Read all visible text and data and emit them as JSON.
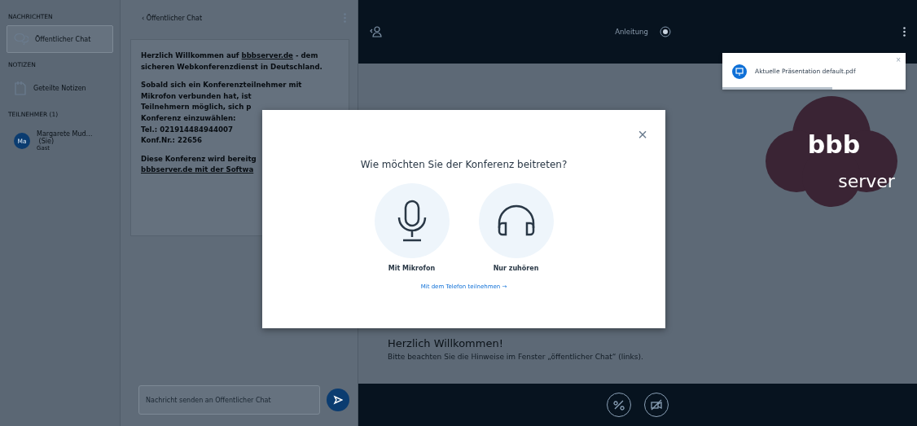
{
  "sidebar": {
    "sections": [
      {
        "title": "NACHRICHTEN",
        "items": [
          {
            "kind": "chat",
            "label": "Öffentlicher Chat",
            "selected": true
          }
        ]
      },
      {
        "title": "NOTIZEN",
        "items": [
          {
            "kind": "notes",
            "label": "Geteilte Notizen",
            "selected": false
          }
        ]
      },
      {
        "title": "TEILNEHMER (1)",
        "items": [
          {
            "kind": "user",
            "avatar": "Ma",
            "label": "Margarete Mud…",
            "suffix": "(Sie)",
            "sub": "Gast",
            "selected": false
          }
        ]
      }
    ]
  },
  "chat": {
    "title": "Öffentlicher Chat",
    "back": "‹",
    "paragraphs": [
      [
        [
          {
            "kind": "bold",
            "text": "Herzlich Willkommen auf "
          },
          {
            "kind": "link",
            "text": "bbbserver.de"
          },
          {
            "kind": "bold",
            "text": " - dem"
          }
        ],
        [
          {
            "kind": "bold",
            "text": "sicheren Webkonferenzdienst in Deutschland."
          }
        ]
      ],
      [
        [
          {
            "kind": "bold",
            "text": "Sobald sich ein Konferenzteilnehmer mit"
          }
        ],
        [
          {
            "kind": "bold",
            "text": "Mikrofon verbunden hat, ist"
          }
        ],
        [
          {
            "kind": "bold",
            "text": "Teilnehmern möglich, sich p"
          }
        ],
        [
          {
            "kind": "bold",
            "text": "Konferenz einzuwählen:"
          }
        ],
        [
          {
            "kind": "bold",
            "text": "Tel.: 021914484944007"
          }
        ],
        [
          {
            "kind": "bold",
            "text": "Konf.Nr.: 22656"
          }
        ]
      ],
      [
        [
          {
            "kind": "bold",
            "text": "Diese Konferenz wird bereitg"
          }
        ],
        [
          {
            "kind": "link",
            "text": "bbbserver.de mit der Softwa"
          }
        ]
      ]
    ],
    "input": {
      "placeholder": "Nachricht senden an Öffentlicher Chat"
    }
  },
  "topbar": {
    "title": "Anleitung"
  },
  "presentation": {
    "logo_top": "bbb",
    "logo_bottom": "server",
    "heading": "Herzlich Willkommen!",
    "hint": "Bitte beachten Sie die Hinweise im Fenster „öffentlicher Chat“ (links)."
  },
  "toast": {
    "text": "Aktuelle Präsentation default.pdf",
    "close": "×",
    "level": 0.6
  },
  "modal": {
    "title": "Wie möchten Sie der Konferenz beitreten?",
    "close": "×",
    "options": [
      {
        "kind": "microphone",
        "label": "Mit Mikrofon"
      },
      {
        "kind": "headphones",
        "label": "Nur zuhören"
      }
    ],
    "link": "Mit dem Telefon teilnehmen →"
  }
}
